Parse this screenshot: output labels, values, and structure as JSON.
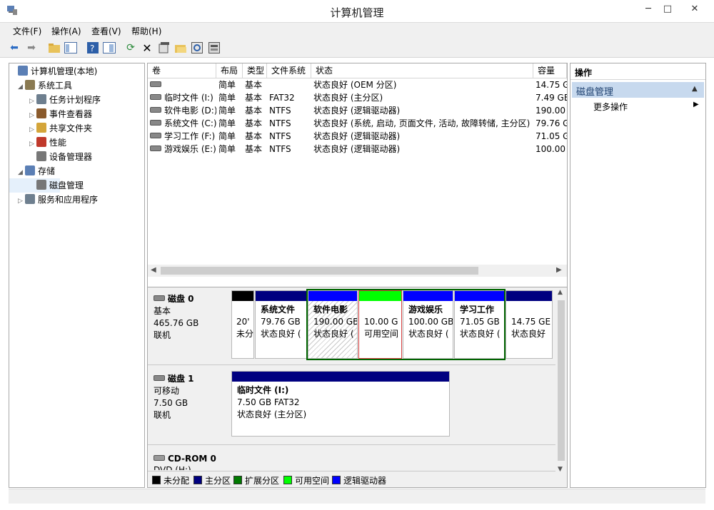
{
  "window": {
    "title": "计算机管理",
    "minimize": "─",
    "maximize": "□",
    "close": "✕"
  },
  "menu": [
    "文件(F)",
    "操作(A)",
    "查看(V)",
    "帮助(H)"
  ],
  "tree": [
    {
      "label": "计算机管理(本地)",
      "icon": "computer-management-icon",
      "arrow": ""
    },
    {
      "label": "系统工具",
      "icon": "system-tools-icon",
      "arrow": "◢"
    },
    {
      "label": "任务计划程序",
      "icon": "task-scheduler-icon",
      "arrow": "▷"
    },
    {
      "label": "事件查看器",
      "icon": "event-viewer-icon",
      "arrow": "▷"
    },
    {
      "label": "共享文件夹",
      "icon": "shared-folders-icon",
      "arrow": "▷"
    },
    {
      "label": "性能",
      "icon": "performance-icon",
      "arrow": "▷"
    },
    {
      "label": "设备管理器",
      "icon": "device-manager-icon",
      "arrow": ""
    },
    {
      "label": "存储",
      "icon": "storage-icon",
      "arrow": "◢"
    },
    {
      "label": "磁盘管理",
      "icon": "disk-management-icon",
      "arrow": ""
    },
    {
      "label": "服务和应用程序",
      "icon": "services-apps-icon",
      "arrow": "▷"
    }
  ],
  "volume_table": {
    "headers": [
      "卷",
      "布局",
      "类型",
      "文件系统",
      "状态",
      "容量"
    ],
    "rows": [
      {
        "vol": "",
        "layout": "简单",
        "type": "基本",
        "fs": "",
        "status": "状态良好 (OEM 分区)",
        "cap": "14.75 G"
      },
      {
        "vol": "临时文件 (I:)",
        "layout": "简单",
        "type": "基本",
        "fs": "FAT32",
        "status": "状态良好 (主分区)",
        "cap": "7.49 GE"
      },
      {
        "vol": "软件电影 (D:)",
        "layout": "简单",
        "type": "基本",
        "fs": "NTFS",
        "status": "状态良好 (逻辑驱动器)",
        "cap": "190.00"
      },
      {
        "vol": "系统文件 (C:)",
        "layout": "简单",
        "type": "基本",
        "fs": "NTFS",
        "status": "状态良好 (系统, 启动, 页面文件, 活动, 故障转储, 主分区)",
        "cap": "79.76 G"
      },
      {
        "vol": "学习工作 (F:)",
        "layout": "简单",
        "type": "基本",
        "fs": "NTFS",
        "status": "状态良好 (逻辑驱动器)",
        "cap": "71.05 G"
      },
      {
        "vol": "游戏娱乐 (E:)",
        "layout": "简单",
        "type": "基本",
        "fs": "NTFS",
        "status": "状态良好 (逻辑驱动器)",
        "cap": "100.00"
      }
    ]
  },
  "disks": [
    {
      "name": "磁盘 0",
      "kind": "基本",
      "size": "465.76 GB",
      "state": "联机"
    },
    {
      "name": "磁盘 1",
      "kind": "可移动",
      "size": "7.50 GB",
      "state": "联机"
    },
    {
      "name": "CD-ROM 0",
      "kind": "DVD (H:)",
      "size": "",
      "state": ""
    }
  ],
  "disk0_parts": [
    {
      "title": "",
      "line1": "20'",
      "line2": "未分",
      "color": "#000000"
    },
    {
      "title": "系统文件",
      "line1": "79.76 GB",
      "line2": "状态良好 (",
      "color": "#000080"
    },
    {
      "title": "软件电影",
      "line1": "190.00 GB",
      "line2": "状态良好 (",
      "color": "#0000ff"
    },
    {
      "title": "",
      "line1": "10.00 G",
      "line2": "可用空间",
      "color": "#00ff00"
    },
    {
      "title": "游戏娱乐",
      "line1": "100.00 GB",
      "line2": "状态良好 (",
      "color": "#0000ff"
    },
    {
      "title": "学习工作",
      "line1": "71.05 GB",
      "line2": "状态良好 (",
      "color": "#0000ff"
    },
    {
      "title": "",
      "line1": "14.75 GE",
      "line2": "状态良好",
      "color": "#000080"
    }
  ],
  "disk1_part": {
    "title": "临时文件  (I:)",
    "line1": "7.50 GB FAT32",
    "line2": "状态良好 (主分区)",
    "color": "#000080"
  },
  "legend": [
    {
      "label": "未分配",
      "color": "#000000"
    },
    {
      "label": "主分区",
      "color": "#000080"
    },
    {
      "label": "扩展分区",
      "color": "#007a00"
    },
    {
      "label": "可用空间",
      "color": "#00ff00"
    },
    {
      "label": "逻辑驱动器",
      "color": "#0000ff"
    }
  ],
  "actions": {
    "header": "操作",
    "section": "磁盘管理",
    "more": "更多操作"
  },
  "colors": {
    "extended_border": "#006400",
    "selected_section": "#c7d9ee"
  }
}
